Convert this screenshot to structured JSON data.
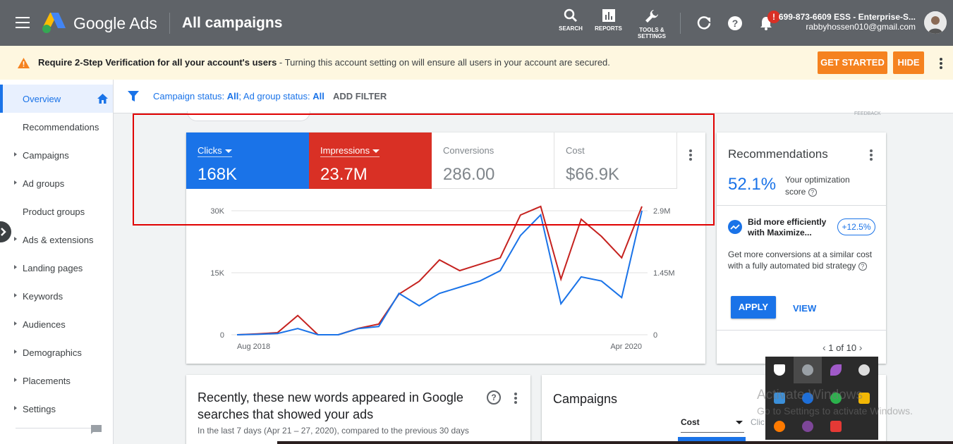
{
  "header": {
    "brand": "Google Ads",
    "page_title": "All campaigns",
    "tools": [
      {
        "label": "SEARCH"
      },
      {
        "label": "REPORTS"
      },
      {
        "label_line1": "TOOLS &",
        "label_line2": "SETTINGS"
      }
    ],
    "notification_badge": "!",
    "account_name": "699-873-6609 ESS - Enterprise-S...",
    "account_email": "rabbyhossen010@gmail.com"
  },
  "banner": {
    "title": "Require 2-Step Verification for all your account's users",
    "text": " - Turning this account setting on will ensure all users in your account are secured.",
    "get_started": "GET STARTED",
    "hide": "HIDE"
  },
  "sidebar": {
    "items": [
      {
        "label": "Overview",
        "active": true
      },
      {
        "label": "Recommendations"
      },
      {
        "label": "Campaigns"
      },
      {
        "label": "Ad groups"
      },
      {
        "label": "Product groups"
      },
      {
        "label": "Ads & extensions"
      },
      {
        "label": "Landing pages"
      },
      {
        "label": "Keywords"
      },
      {
        "label": "Audiences"
      },
      {
        "label": "Demographics"
      },
      {
        "label": "Placements"
      },
      {
        "label": "Settings"
      }
    ]
  },
  "filters": {
    "campaign_status_label": "Campaign status: ",
    "campaign_status_value": "All",
    "ad_group_status_label": "; Ad group status: ",
    "ad_group_status_value": "All",
    "add_filter": "ADD FILTER",
    "feedback": "FEEDBACK"
  },
  "metrics": [
    {
      "label": "Clicks",
      "value": "168K"
    },
    {
      "label": "Impressions",
      "value": "23.7M"
    },
    {
      "label": "Conversions",
      "value": "286.00"
    },
    {
      "label": "Cost",
      "value": "$66.9K"
    }
  ],
  "chart_data": {
    "type": "line",
    "x": [
      "Aug 2018",
      "Sep 2018",
      "Oct 2018",
      "Nov 2018",
      "Dec 2018",
      "Jan 2019",
      "Feb 2019",
      "Mar 2019",
      "Apr 2019",
      "May 2019",
      "Jun 2019",
      "Jul 2019",
      "Aug 2019",
      "Sep 2019",
      "Oct 2019",
      "Nov 2019",
      "Dec 2019",
      "Jan 2020",
      "Feb 2020",
      "Mar 2020",
      "Apr 2020"
    ],
    "x_tick_labels": [
      "Aug 2018",
      "Apr 2020"
    ],
    "series": [
      {
        "name": "Clicks",
        "axis": "left",
        "color": "#1a73e8",
        "values": [
          0,
          100,
          300,
          1500,
          0,
          0,
          1500,
          2000,
          10000,
          7000,
          10000,
          11500,
          13000,
          15500,
          24000,
          29000,
          7500,
          14000,
          13000,
          9000,
          30000
        ]
      },
      {
        "name": "Impressions",
        "axis": "right",
        "color": "#c5221f",
        "values": [
          0,
          20000,
          50000,
          450000,
          0,
          0,
          150000,
          250000,
          950000,
          1250000,
          1750000,
          1500000,
          1650000,
          1800000,
          2800000,
          3000000,
          1300000,
          2700000,
          2300000,
          1800000,
          3000000
        ]
      }
    ],
    "left_ticks": [
      "0",
      "15K",
      "30K"
    ],
    "right_ticks": [
      "0",
      "1.45M",
      "2.9M"
    ],
    "ylim_left": [
      0,
      30000
    ],
    "ylim_right": [
      0,
      2900000
    ]
  },
  "recommendations": {
    "title": "Recommendations",
    "score": "52.1%",
    "score_label_line1": "Your optimization",
    "score_label_line2": "score",
    "bid_title_line1": "Bid more efficiently",
    "bid_title_line2": "with Maximize...",
    "bid_pill": "+12.5%",
    "bid_desc": "Get more conversions at a similar cost with a fully automated bid strategy",
    "apply": "APPLY",
    "view": "VIEW",
    "pager": "1 of 10"
  },
  "new_words": {
    "title": "Recently, these new words appeared in Google searches that showed your ads",
    "subtitle": "In the last 7 days (Apr 21 – 27, 2020), compared to the previous 30 days"
  },
  "campaigns": {
    "title": "Campaigns",
    "sort_select": "Cost",
    "next_col": "Clic"
  },
  "watermark": {
    "line1": "Activate Windows",
    "line2": "Go to Settings to activate Windows."
  }
}
